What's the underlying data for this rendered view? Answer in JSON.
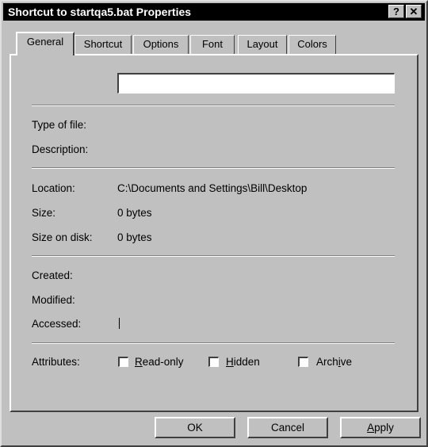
{
  "window": {
    "title": "Shortcut to startqa5.bat Properties",
    "help_glyph": "?",
    "close_glyph": "✕"
  },
  "tabs": [
    {
      "label": "General",
      "active": true
    },
    {
      "label": "Shortcut",
      "active": false
    },
    {
      "label": "Options",
      "active": false
    },
    {
      "label": "Font",
      "active": false
    },
    {
      "label": "Layout",
      "active": false
    },
    {
      "label": "Colors",
      "active": false
    }
  ],
  "general": {
    "name_value": "",
    "type_label": "Type of file:",
    "type_value": "",
    "description_label": "Description:",
    "description_value": "",
    "location_label": "Location:",
    "location_value": "C:\\Documents and Settings\\Bill\\Desktop",
    "size_label": "Size:",
    "size_value": "0 bytes",
    "size_on_disk_label": "Size on disk:",
    "size_on_disk_value": "0 bytes",
    "created_label": "Created:",
    "created_value": "",
    "modified_label": "Modified:",
    "modified_value": "",
    "accessed_label": "Accessed:",
    "accessed_value": "",
    "attributes_label": "Attributes:",
    "attributes": {
      "readonly": {
        "pre": "",
        "key": "R",
        "post": "ead-only",
        "checked": false
      },
      "hidden": {
        "pre": "",
        "key": "H",
        "post": "idden",
        "checked": false
      },
      "archive": {
        "pre": "Arch",
        "key": "i",
        "post": "ve",
        "checked": false
      }
    }
  },
  "buttons": {
    "ok": "OK",
    "cancel": "Cancel",
    "apply_key": "A",
    "apply_rest": "pply"
  }
}
